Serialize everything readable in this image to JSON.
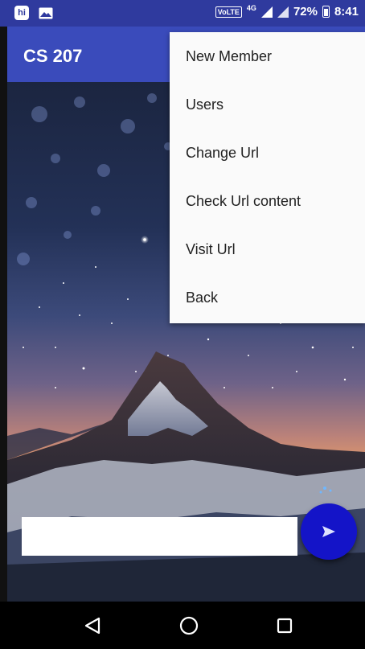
{
  "status_bar": {
    "volte": "VoLTE",
    "network": "4G",
    "battery": "72%",
    "time": "8:41",
    "hi_label": "hi"
  },
  "app_bar": {
    "title": "CS 207"
  },
  "menu": {
    "items": [
      {
        "label": "New Member"
      },
      {
        "label": "Users"
      },
      {
        "label": "Change Url"
      },
      {
        "label": "Check Url content"
      },
      {
        "label": "Visit Url"
      },
      {
        "label": "Back"
      }
    ]
  },
  "composer": {
    "input_value": "",
    "placeholder": ""
  },
  "icons": {
    "send": "send-icon",
    "back": "back-triangle-icon",
    "home": "home-circle-icon",
    "recents": "recents-square-icon"
  },
  "colors": {
    "status_bar": "#2f3a9e",
    "app_bar": "#3a4bbb",
    "send_button": "#1414c8",
    "menu_bg": "#fafafa"
  }
}
